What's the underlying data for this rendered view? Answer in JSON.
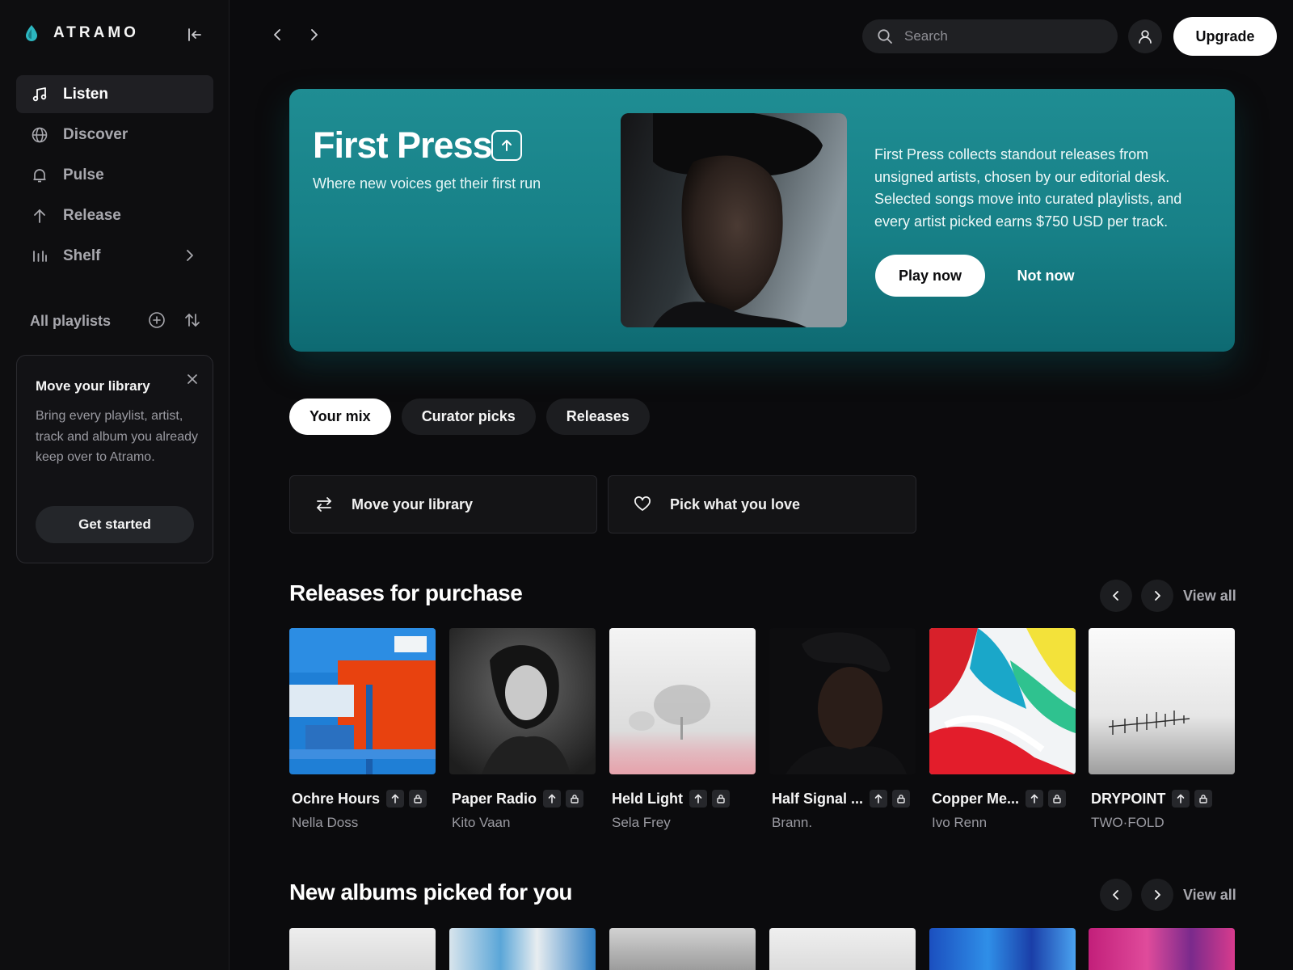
{
  "app": {
    "name": "ATRAMO"
  },
  "sidebar": {
    "items": [
      {
        "label": "Listen",
        "icon": "music-note-icon",
        "active": true
      },
      {
        "label": "Discover",
        "icon": "globe-icon",
        "active": false
      },
      {
        "label": "Pulse",
        "icon": "bell-icon",
        "active": false
      },
      {
        "label": "Release",
        "icon": "arrow-up-icon",
        "active": false
      },
      {
        "label": "Shelf",
        "icon": "library-bars-icon",
        "active": false
      }
    ],
    "playlists_label": "All playlists",
    "promo": {
      "title": "Move your library",
      "body": "Bring every playlist, artist, track and album you already keep over to Atramo.",
      "button": "Get started"
    }
  },
  "topbar": {
    "search_placeholder": "Search",
    "upgrade_label": "Upgrade"
  },
  "hero": {
    "title": "First Press",
    "subtitle": "Where new voices get their first run",
    "description": "First Press collects standout releases from unsigned artists, chosen by our editorial desk. Selected songs move into curated playlists, and every artist picked earns $750 USD per track.",
    "play_label": "Play now",
    "dismiss_label": "Not now"
  },
  "tabs": [
    {
      "label": "Your mix",
      "active": true
    },
    {
      "label": "Curator picks",
      "active": false
    },
    {
      "label": "Releases",
      "active": false
    }
  ],
  "actions": [
    {
      "label": "Move your library",
      "icon": "transfer-arrows-icon"
    },
    {
      "label": "Pick what you love",
      "icon": "heart-icon"
    }
  ],
  "releases": {
    "title": "Releases for purchase",
    "view_all": "View all",
    "items": [
      {
        "title": "Ochre Hours",
        "artist": "Nella Doss"
      },
      {
        "title": "Paper Radio",
        "artist": "Kito Vaan"
      },
      {
        "title": "Held Light",
        "artist": "Sela Frey"
      },
      {
        "title": "Half Signal ...",
        "artist": "Brann."
      },
      {
        "title": "Copper Me...",
        "artist": "Ivo Renn"
      },
      {
        "title": "DRYPOINT",
        "artist": "TWO·FOLD"
      }
    ]
  },
  "new_albums": {
    "title": "New albums picked for you",
    "view_all": "View all"
  },
  "colors": {
    "background": "#0b0b0d",
    "hero_teal": "#178087",
    "accent_teal": "#2cb6c0"
  }
}
